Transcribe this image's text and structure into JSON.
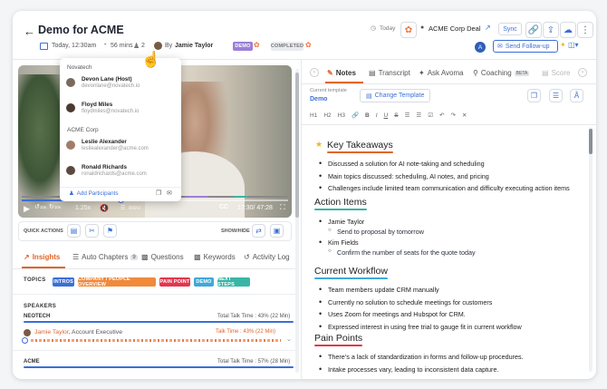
{
  "header": {
    "title": "Demo for ACME",
    "date": "Today, 12:30am",
    "duration": "56 mins",
    "participant_count": "2",
    "by_label": "By",
    "owner": "Jamie Taylor",
    "stage_demo": "DEMO",
    "stage_completed": "COMPLETED",
    "today": "Today",
    "deal": "ACME Corp Deal",
    "sync": "Sync",
    "avatar_letter": "A",
    "send_followup": "Send Follow-up"
  },
  "popup": {
    "group1": "Novatech",
    "group2": "ACME Corp",
    "people": [
      {
        "name": "Devon Lane (Host)",
        "email": "devonlane@novatech.io"
      },
      {
        "name": "Floyd Miles",
        "email": "floydmiles@novatech.io"
      },
      {
        "name": "Leslie Alexander",
        "email": "lesliealexander@acme.com"
      },
      {
        "name": "Ronald Richards",
        "email": "ronaldrichards@acme.com"
      }
    ],
    "add": "Add Participants"
  },
  "player": {
    "rewind": "10s",
    "forward": "10s",
    "speed": "1.25x",
    "chapter": "Intro",
    "time": "17:30/ 47:28",
    "progress": 0.37
  },
  "actions": {
    "quick": "QUICK ACTIONS",
    "showhide": "SHOW/HIDE"
  },
  "left_tabs": {
    "insights": "Insights",
    "chapters": "Auto Chapters",
    "chapters_count": "9",
    "questions": "Questions",
    "keywords": "Keywords",
    "activity": "Activity Log"
  },
  "topics": {
    "label": "TOPICS",
    "items": [
      "INTROS",
      "COMPANY / PEOPLE OVERVIEW",
      "PAIN POINT",
      "DEMO",
      "NEXT STEPS"
    ],
    "colors": [
      "#3b6fd6",
      "#f08a3c",
      "#e0384e",
      "#3fa8d8",
      "#39b5a6"
    ]
  },
  "speakers": {
    "label": "SPEAKERS",
    "org1": "NEOTECH",
    "total1": "Total Talk Time : 43% (22 Min)",
    "speaker1": "Jamie Taylor",
    "role1": ", Account Executive",
    "talk1": "Talk Time : 43% (22 Min)",
    "org2": "ACME",
    "total2": "Total Talk Time : 57% (28 Min)"
  },
  "right_tabs": {
    "notes": "Notes",
    "transcript": "Transcript",
    "ask": "Ask Avoma",
    "coaching": "Coaching",
    "beta": "BETA",
    "scorecard": "Score"
  },
  "template": {
    "label": "Current template",
    "value": "Demo",
    "change": "Change Template"
  },
  "toolbar": {
    "h1": "H1",
    "h2": "H2",
    "h3": "H3",
    "b": "B",
    "i": "I",
    "u": "U",
    "s": "S"
  },
  "notes": {
    "key_title": "Key Takeaways",
    "key": [
      "Discussed a solution for AI note-taking and scheduling",
      "Main topics discussed: scheduling, AI notes, and pricing",
      "Challenges include limited team communication and difficulty executing action items"
    ],
    "action_title": "Action Items",
    "a1": "Jamie Taylor",
    "a1s": "Send to proposal by tomorrow",
    "a2": "Kim Fields",
    "a2s": "Confirm the number of seats for the quote today",
    "wf_title": "Current Workflow",
    "wf": [
      "Team members update CRM manually",
      "Currently no solution to schedule meetings for customers",
      "Uses Zoom for meetings and Hubspot for CRM.",
      "Expressed interest in using free trial to gauge fit in current workflow"
    ],
    "pp_title": "Pain Points",
    "pp": [
      "There’s a lack of standardization in forms and follow-up procedures.",
      "Intake processes vary, leading to inconsistent data capture."
    ]
  }
}
